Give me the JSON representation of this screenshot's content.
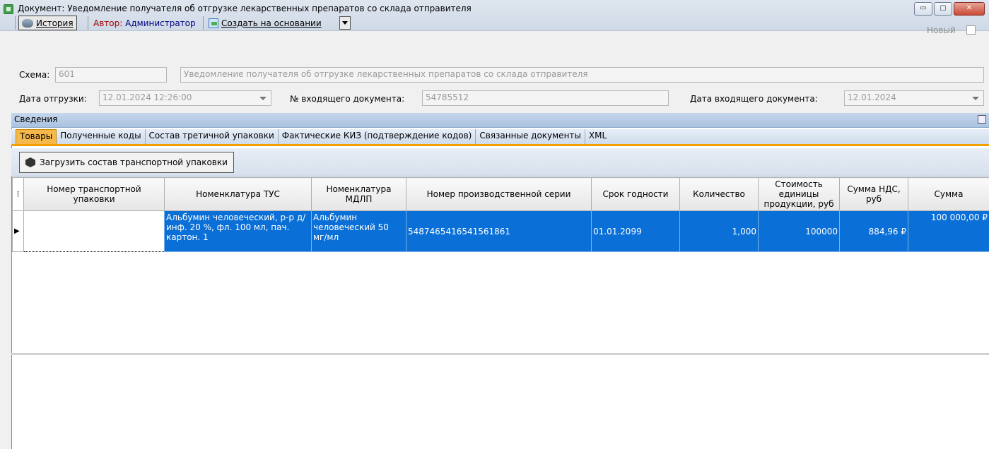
{
  "window": {
    "title": "Документ: Уведомление получателя об отгрузке лекарственных препаратов со склада отправителя",
    "min_glyph": "▭",
    "max_glyph": "▢",
    "close_glyph": "✕"
  },
  "toolbar": {
    "history_label": "История",
    "author_label": "Автор:",
    "author_value": "Администратор",
    "create_label": "Создать на основании",
    "new_label": "Новый"
  },
  "form": {
    "scheme_label": "Схема:",
    "scheme_code": "601",
    "scheme_name": "Уведомление получателя об отгрузке лекарственных препаратов со склада отправителя",
    "ship_date_label": "Дата отгрузки:",
    "ship_date_value": "12.01.2024 12:26:00",
    "incoming_no_label": "№ входящего документа:",
    "incoming_no_value": "54785512",
    "incoming_date_label": "Дата входящего документа:",
    "incoming_date_value": "12.01.2024"
  },
  "section": {
    "title": "Сведения"
  },
  "tabs": [
    {
      "label": "Товары",
      "active": true
    },
    {
      "label": "Полученные коды",
      "active": false
    },
    {
      "label": "Состав третичной упаковки",
      "active": false
    },
    {
      "label": "Фактические КИЗ (подтверждение кодов)",
      "active": false
    },
    {
      "label": "Связанные документы",
      "active": false
    },
    {
      "label": "XML",
      "active": false
    }
  ],
  "actions": {
    "load_label": "Загрузить состав транспортной упаковки"
  },
  "grid": {
    "columns": [
      "Номер транспортной упаковки",
      "Номенклатура ТУС",
      "Номенклатура МДЛП",
      "Номер производственной серии",
      "Срок годности",
      "Количество",
      "Стоимость единицы продукции, руб",
      "Сумма НДС, руб",
      "Сумма"
    ],
    "rows": [
      {
        "transport_no": "",
        "tus": "Альбумин человеческий, р-р д/инф. 20 %, фл. 100 мл, пач. картон. 1",
        "mdlp": "Альбумин человеческий 50 мг/мл",
        "series": "5487465416541561861",
        "expiry": "01.01.2099",
        "qty": "1,000",
        "unit_price": "100000",
        "vat": "884,96 ₽",
        "sum": "100 000,00 ₽"
      }
    ]
  },
  "colors": {
    "selected_row": "#0a6fd6",
    "active_tab": "#f5b84a",
    "tab_underline": "#f2a000"
  }
}
